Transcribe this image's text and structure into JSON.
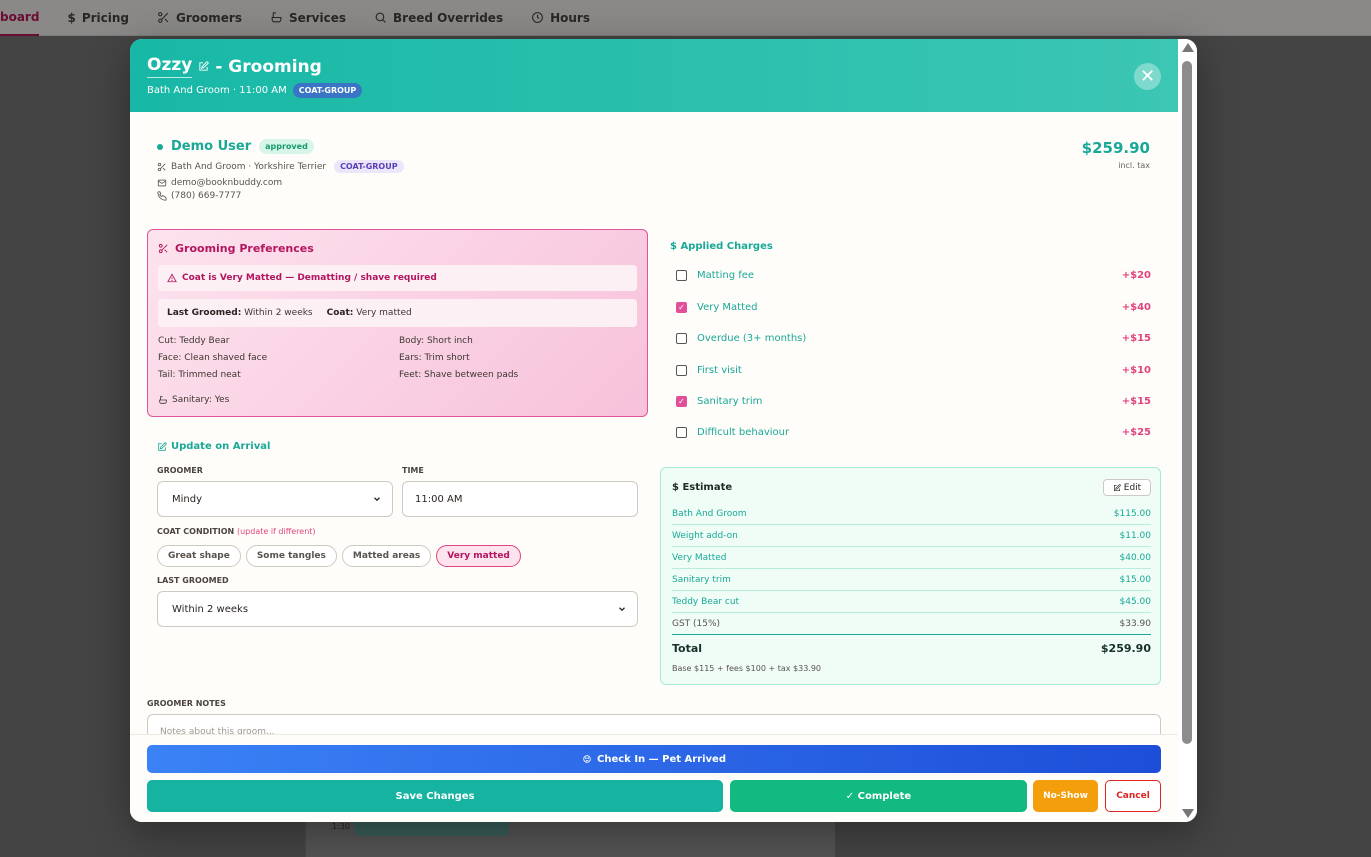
{
  "nav": {
    "items": [
      {
        "label": "board",
        "icon": "dashboard-icon"
      },
      {
        "label": "Pricing",
        "icon": "dollar-icon"
      },
      {
        "label": "Groomers",
        "icon": "scissors-icon"
      },
      {
        "label": "Services",
        "icon": "bath-icon"
      },
      {
        "label": "Breed Overrides",
        "icon": "search-icon"
      },
      {
        "label": "Hours",
        "icon": "clock-icon"
      }
    ]
  },
  "calendar": {
    "time_label": "1:30"
  },
  "header": {
    "pet_name": "Ozzy",
    "title_suffix": "- Grooming",
    "subtitle": "Bath And Groom · 11:00 AM",
    "coat_group": "COAT-GROUP",
    "close_symbol": "✕"
  },
  "client": {
    "name": "Demo User",
    "status": "approved",
    "service_breed": "Bath And Groom · Yorkshire Terrier",
    "coat_group": "COAT-GROUP",
    "email": "demo@booknbuddy.com",
    "phone": "(780) 669-7777"
  },
  "price_summary": {
    "total": "$259.90",
    "note": "incl. tax"
  },
  "prefs": {
    "title": "Grooming Preferences",
    "warning": "Coat is Very Matted — Dematting / shave required",
    "last_groomed_label": "Last Groomed:",
    "last_groomed_value": "Within 2 weeks",
    "coat_label": "Coat:",
    "coat_value": "Very matted",
    "items": [
      "Cut: Teddy Bear",
      "Body: Short inch",
      "Face: Clean shaved face",
      "Ears: Trim short",
      "Tail: Trimmed neat",
      "Feet: Shave between pads"
    ],
    "sanitary": "Sanitary: Yes"
  },
  "charges": {
    "title": "$ Applied Charges",
    "items": [
      {
        "label": "Matting fee",
        "amount": "+$20",
        "checked": false
      },
      {
        "label": "Very Matted",
        "amount": "+$40",
        "checked": true
      },
      {
        "label": "Overdue (3+ months)",
        "amount": "+$15",
        "checked": false
      },
      {
        "label": "First visit",
        "amount": "+$10",
        "checked": false
      },
      {
        "label": "Sanitary trim",
        "amount": "+$15",
        "checked": true
      },
      {
        "label": "Difficult behaviour",
        "amount": "+$25",
        "checked": false
      }
    ]
  },
  "arrival": {
    "title": "Update on Arrival",
    "groomer_label": "GROOMER",
    "groomer_value": "Mindy",
    "time_label": "TIME",
    "time_value": "11:00 AM",
    "coat_label": "COAT CONDITION",
    "coat_hint": "(update if different)",
    "coat_options": [
      "Great shape",
      "Some tangles",
      "Matted areas",
      "Very matted"
    ],
    "coat_selected": "Very matted",
    "last_groomed_label": "LAST GROOMED",
    "last_groomed_value": "Within 2 weeks"
  },
  "estimate": {
    "title": "$ Estimate",
    "edit_label": "Edit",
    "rows": [
      {
        "label": "Bath And Groom",
        "value": "$115.00"
      },
      {
        "label": "Weight add-on",
        "value": "$11.00"
      },
      {
        "label": "Very Matted",
        "value": "$40.00"
      },
      {
        "label": "Sanitary trim",
        "value": "$15.00"
      },
      {
        "label": "Teddy Bear cut",
        "value": "$45.00"
      },
      {
        "label": "GST (15%)",
        "value": "$33.90"
      }
    ],
    "total_label": "Total",
    "total_value": "$259.90",
    "footnote": "Base $115 + fees $100 + tax $33.90"
  },
  "notes": {
    "label": "GROOMER NOTES",
    "placeholder": "Notes about this groom..."
  },
  "actions": {
    "checkin": "Check In — Pet Arrived",
    "save": "Save Changes",
    "complete": "✓ Complete",
    "noshow": "No-Show",
    "cancel": "Cancel"
  }
}
